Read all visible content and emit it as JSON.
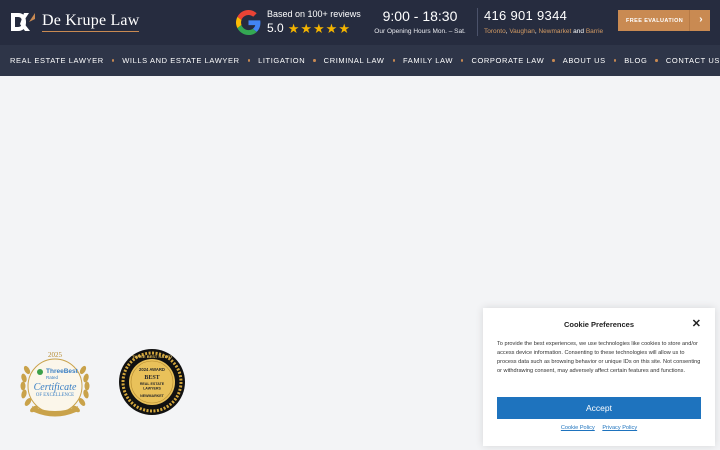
{
  "header": {
    "brand": "De Krupe Law",
    "logo_mark": "DK",
    "google": {
      "caption": "Based on 100+ reviews",
      "score": "5.0",
      "stars": 5,
      "icon": "google-g-icon"
    },
    "hours": {
      "time": "9:00 - 18:30",
      "caption": "Our Opening Hours Mon. – Sat."
    },
    "phone": {
      "number": "416 901 9344",
      "locations": [
        "Toronto",
        "Vaughan",
        "Newmarket",
        "Barrie"
      ],
      "sep1": ", ",
      "sep2": ", ",
      "sep3": " and "
    },
    "cta": {
      "label": "FREE EVALUATION",
      "arrow": "›"
    }
  },
  "nav": {
    "items": [
      {
        "label": "REAL ESTATE LAWYER"
      },
      {
        "label": "WILLS AND ESTATE LAWYER"
      },
      {
        "label": "LITIGATION"
      },
      {
        "label": "CRIMINAL LAW"
      },
      {
        "label": "FAMILY LAW"
      },
      {
        "label": "CORPORATE LAW"
      },
      {
        "label": "ABOUT US"
      },
      {
        "label": "BLOG"
      },
      {
        "label": "CONTACT US"
      }
    ]
  },
  "badges": {
    "threebest": {
      "year": "2025",
      "brand": "ThreeBest",
      "rated": "Rated",
      "title": "Certificate",
      "subtitle": "OF EXCELLENCE"
    },
    "award": {
      "top": "THREE BEST RATED",
      "year": "2024 AWARD",
      "best": "BEST",
      "category": "REAL ESTATE",
      "category2": "LAWYERS",
      "city": "NEWMARKET"
    }
  },
  "cookie": {
    "title": "Cookie Preferences",
    "close": "✕",
    "body": "To provide the best experiences, we use technologies like cookies to store and/or access device information. Consenting to these technologies will allow us to process data such as browsing behavior or unique IDs on this site. Not consenting or withdrawing consent, may adversely affect certain features and functions.",
    "accept_label": "Accept",
    "links": [
      "Cookie Policy",
      "Privacy Policy"
    ]
  },
  "colors": {
    "header_bg": "#262c3f",
    "nav_bg": "#2e3548",
    "accent": "#c98a52",
    "accept_blue": "#1e73be",
    "page_bg": "#f3f4f6"
  }
}
